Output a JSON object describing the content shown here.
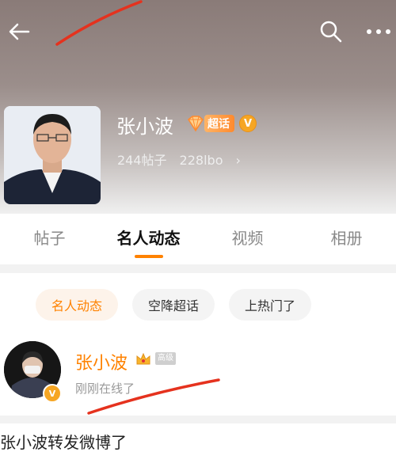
{
  "profile": {
    "name": "张小波",
    "super_topic_badge": "超话",
    "verified_badge": "V",
    "stats": {
      "posts": "244帖子",
      "weibo": "228lbo"
    }
  },
  "tabs": [
    {
      "label": "帖子"
    },
    {
      "label": "名人动态",
      "active": true
    },
    {
      "label": "视频"
    },
    {
      "label": "相册"
    }
  ],
  "filters": [
    {
      "label": "名人动态",
      "active": true
    },
    {
      "label": "空降超话"
    },
    {
      "label": "上热门了"
    }
  ],
  "post": {
    "author": "张小波",
    "tag": "高级",
    "status": "刚刚在线了",
    "verified_badge": "V"
  },
  "repost": {
    "text": "张小波转发微博了"
  },
  "colors": {
    "accent": "#ff8200",
    "annotation": "#e5321e"
  }
}
